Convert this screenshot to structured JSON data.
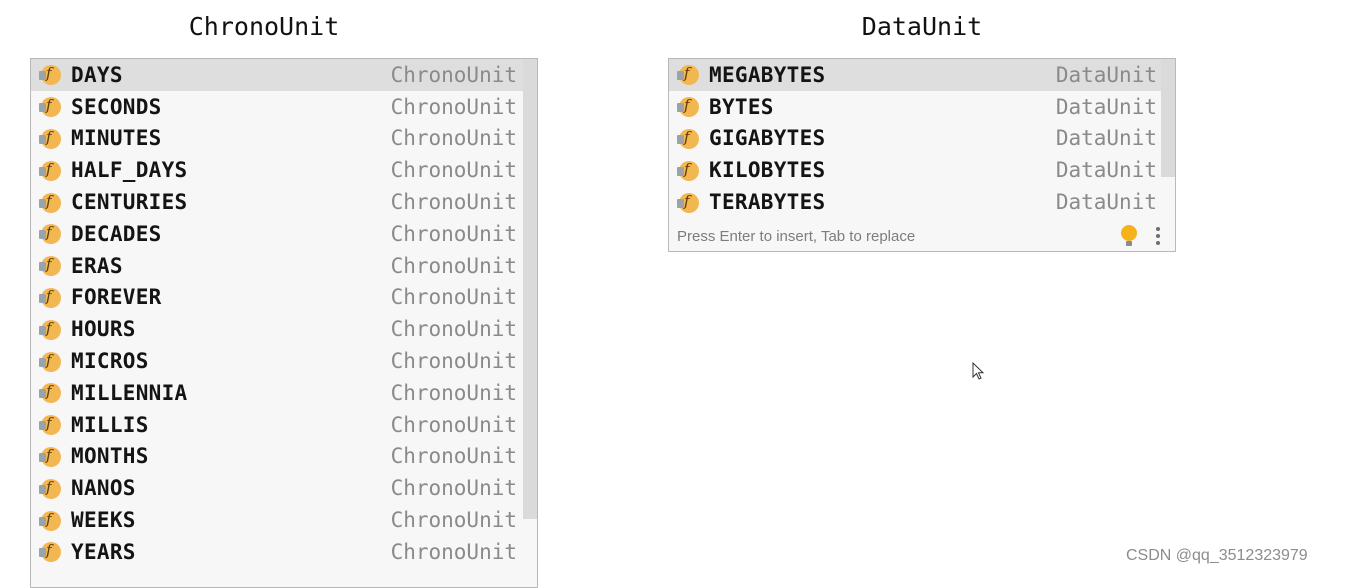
{
  "titles": {
    "left": "ChronoUnit",
    "right": "DataUnit"
  },
  "chrono": {
    "type_label": "ChronoUnit",
    "selected_index": 0,
    "items": [
      {
        "name": "DAYS",
        "type": "ChronoUnit"
      },
      {
        "name": "SECONDS",
        "type": "ChronoUnit"
      },
      {
        "name": "MINUTES",
        "type": "ChronoUnit"
      },
      {
        "name": "HALF_DAYS",
        "type": "ChronoUnit"
      },
      {
        "name": "CENTURIES",
        "type": "ChronoUnit"
      },
      {
        "name": "DECADES",
        "type": "ChronoUnit"
      },
      {
        "name": "ERAS",
        "type": "ChronoUnit"
      },
      {
        "name": "FOREVER",
        "type": "ChronoUnit"
      },
      {
        "name": "HOURS",
        "type": "ChronoUnit"
      },
      {
        "name": "MICROS",
        "type": "ChronoUnit"
      },
      {
        "name": "MILLENNIA",
        "type": "ChronoUnit"
      },
      {
        "name": "MILLIS",
        "type": "ChronoUnit"
      },
      {
        "name": "MONTHS",
        "type": "ChronoUnit"
      },
      {
        "name": "NANOS",
        "type": "ChronoUnit"
      },
      {
        "name": "WEEKS",
        "type": "ChronoUnit"
      },
      {
        "name": "YEARS",
        "type": "ChronoUnit"
      }
    ]
  },
  "data": {
    "selected_index": 0,
    "items": [
      {
        "name": "MEGABYTES",
        "type": "DataUnit"
      },
      {
        "name": "BYTES",
        "type": "DataUnit"
      },
      {
        "name": "GIGABYTES",
        "type": "DataUnit"
      },
      {
        "name": "KILOBYTES",
        "type": "DataUnit"
      },
      {
        "name": "TERABYTES",
        "type": "DataUnit"
      }
    ],
    "footer_hint": "Press Enter to insert, Tab to replace"
  },
  "icons": {
    "item_icon": "field-icon",
    "bulb": "lightbulb-icon",
    "menu": "more-vertical-icon",
    "cursor": "mouse-cursor-icon"
  },
  "colors": {
    "field_icon": "#f3b752",
    "selected_row": "#dedede",
    "popup_bg": "#f7f7f7",
    "bulb": "#f6b21b"
  },
  "watermark": "CSDN @qq_3512323979"
}
